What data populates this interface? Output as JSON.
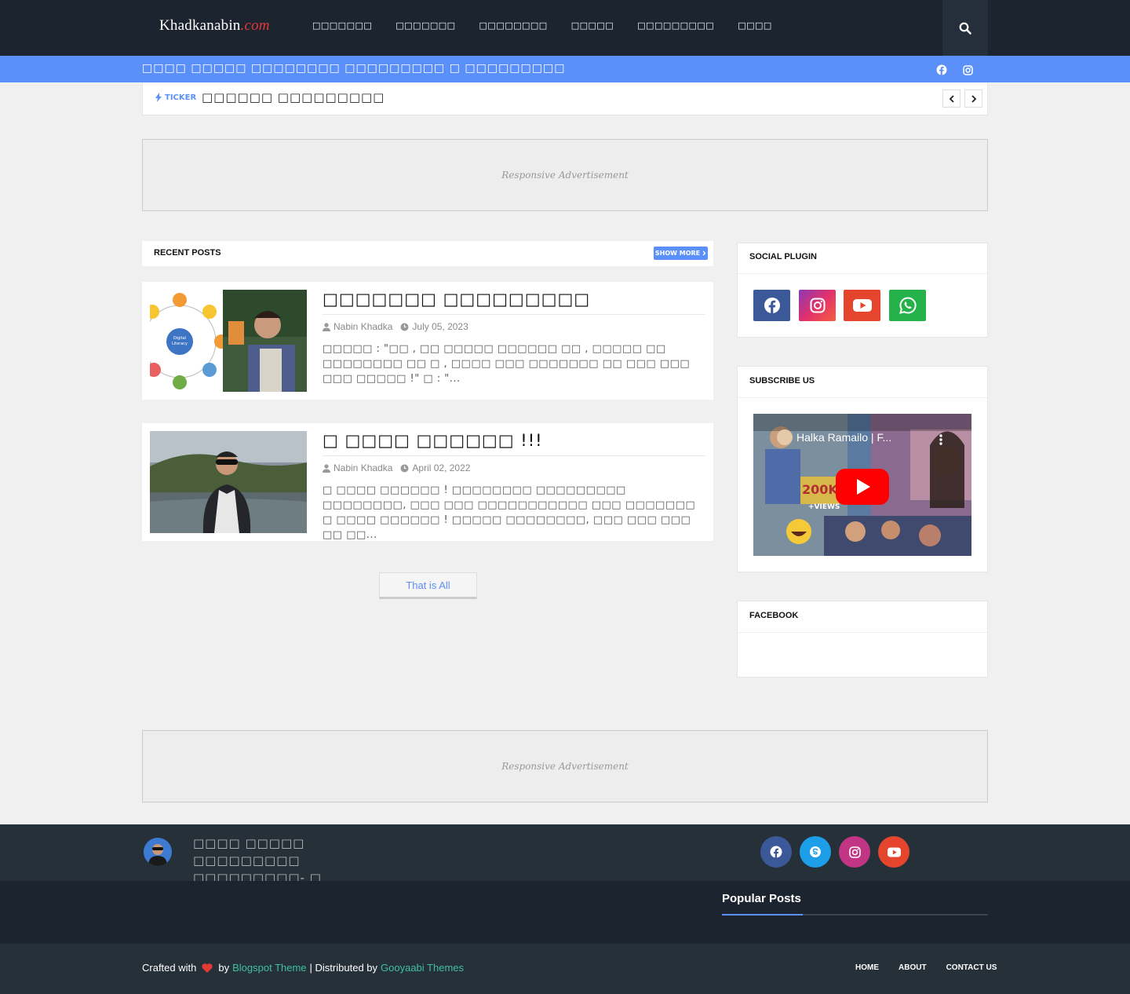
{
  "header": {
    "logo_text": "Khadkanabin",
    "logo_suffix": ".com",
    "nav": [
      "□□□□□□□",
      "□□□□□□□",
      "□□□□□□□□",
      "□□□□□",
      "□□□□□□□□□",
      "□□□□"
    ],
    "tagline": "□□□□ □□□□□ □□□□□□□□ □□□□□□□□□ □ □□□□□□□□□"
  },
  "ticker": {
    "label": "TICKER",
    "text": "□□□□□□ □□□□□□□□□"
  },
  "ads": {
    "label": "Responsive Advertisement"
  },
  "recent_posts": {
    "title": "RECENT POSTS",
    "show_more": "SHOW MORE",
    "posts": [
      {
        "title": "□□□□□□□ □□□□□□□□□",
        "author": "Nabin Khadka",
        "date": "July 05, 2023",
        "excerpt": "□□□□□ : \"□□ , □□ □□□□□ □□□□□□ □□ , □□□□□ □□ □□□□□□□□ □□ □ , □□□□ □□□ □□□□□□□ □□ □□□ □□□ □□□ □□□□□ !\" □ : \"..."
      },
      {
        "title": "□ □□□□ □□□□□□ !!!",
        "author": "Nabin Khadka",
        "date": "April 02, 2022",
        "excerpt": "□ □□□□ □□□□□□ ! □□□□□□□□ □□□□□□□□□ □□□□□□□□, □□□ □□□ □□□□□□□□□□□ □□□ □□□□□□□ □ □□□□ □□□□□□ ! □□□□□ □□□□□□□□, □□□ □□□ □□□ □□ □□..."
      }
    ],
    "end_label": "That is All"
  },
  "sidebar": {
    "social_title": "SOCIAL PLUGIN",
    "subscribe_title": "SUBSCRIBE US",
    "video_title": "Halka Ramailo | F...",
    "video_badge": "200K",
    "video_views": "+VIEWS",
    "facebook_title": "FACEBOOK",
    "social_colors": {
      "facebook": "#3b5998",
      "instagram": "#c13584",
      "youtube": "#e5452c",
      "whatsapp": "#25b24a"
    }
  },
  "footer": {
    "tagline": "□□□□ □□□□□ □□□□□□□□□ □□□□□□□□□- □ □□□□□□□□□",
    "popular_title": "Popular Posts",
    "credit_prefix": "Crafted with",
    "credit_by": "by",
    "credit_theme": "Blogspot Theme",
    "credit_dist": "| Distributed by",
    "credit_author": "Gooyaabi Themes",
    "links": [
      "HOME",
      "ABOUT",
      "CONTACT US"
    ],
    "social_colors": {
      "facebook": "#3b5998",
      "skype": "#1d9ee9",
      "instagram": "#c13584",
      "youtube": "#e5452c"
    }
  }
}
